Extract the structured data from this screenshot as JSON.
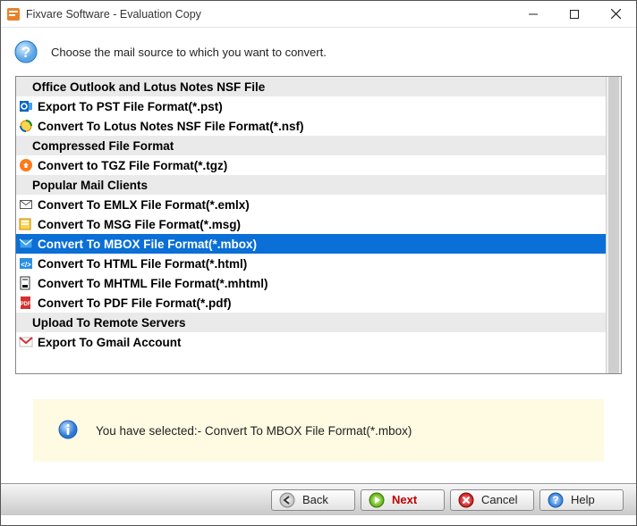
{
  "window": {
    "title": "Fixvare Software - Evaluation Copy"
  },
  "instruction": "Choose the mail source to which you want to convert.",
  "list": [
    {
      "type": "header",
      "label": "Office Outlook and Lotus Notes NSF File"
    },
    {
      "type": "item",
      "icon": "outlook-icon",
      "label": "Export To PST File Format(*.pst)"
    },
    {
      "type": "item",
      "icon": "lotus-icon",
      "label": "Convert To Lotus Notes NSF File Format(*.nsf)"
    },
    {
      "type": "header",
      "label": "Compressed File Format"
    },
    {
      "type": "item",
      "icon": "tgz-icon",
      "label": "Convert to TGZ File Format(*.tgz)"
    },
    {
      "type": "header",
      "label": "Popular Mail Clients"
    },
    {
      "type": "item",
      "icon": "emlx-icon",
      "label": "Convert To EMLX File Format(*.emlx)"
    },
    {
      "type": "item",
      "icon": "msg-icon",
      "label": "Convert To MSG File Format(*.msg)"
    },
    {
      "type": "item",
      "icon": "mbox-icon",
      "label": "Convert To MBOX File Format(*.mbox)",
      "selected": true
    },
    {
      "type": "item",
      "icon": "html-icon",
      "label": "Convert To HTML File Format(*.html)"
    },
    {
      "type": "item",
      "icon": "mhtml-icon",
      "label": "Convert To MHTML File Format(*.mhtml)"
    },
    {
      "type": "item",
      "icon": "pdf-icon",
      "label": "Convert To PDF File Format(*.pdf)"
    },
    {
      "type": "header",
      "label": "Upload To Remote Servers"
    },
    {
      "type": "item",
      "icon": "gmail-icon",
      "label": "Export To Gmail Account"
    }
  ],
  "status": {
    "text": "You have selected:- Convert To MBOX File Format(*.mbox)"
  },
  "buttons": {
    "back": "Back",
    "next": "Next",
    "cancel": "Cancel",
    "help": "Help"
  }
}
